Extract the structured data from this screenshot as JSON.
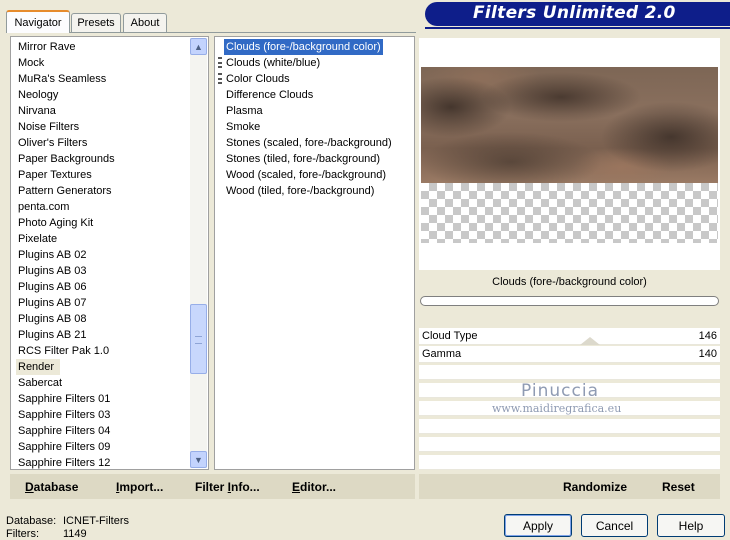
{
  "tabs": [
    "Navigator",
    "Presets",
    "About"
  ],
  "banner_title": "Filters Unlimited 2.0",
  "categories": [
    "Mirror Rave",
    "Mock",
    "MuRa's Seamless",
    "Neology",
    "Nirvana",
    "Noise Filters",
    "Oliver's Filters",
    "Paper Backgrounds",
    "Paper Textures",
    "Pattern Generators",
    "penta.com",
    "Photo Aging Kit",
    "Pixelate",
    "Plugins AB 02",
    "Plugins AB 03",
    "Plugins AB 06",
    "Plugins AB 07",
    "Plugins AB 08",
    "Plugins AB 21",
    "RCS Filter Pak 1.0",
    "Render",
    "Sabercat",
    "Sapphire Filters 01",
    "Sapphire Filters 03",
    "Sapphire Filters 04",
    "Sapphire Filters 09",
    "Sapphire Filters 12"
  ],
  "selected_category": "Render",
  "filters": [
    "Clouds (fore-/background color)",
    "Clouds (white/blue)",
    "Color Clouds",
    "Difference Clouds",
    "Plasma",
    "Smoke",
    "Stones (scaled, fore-/background)",
    "Stones (tiled, fore-/background)",
    "Wood (scaled, fore-/background)",
    "Wood (tiled, fore-/background)"
  ],
  "selected_filter": "Clouds (fore-/background color)",
  "preview_filter_name": "Clouds (fore-/background color)",
  "sliders": [
    {
      "label": "Cloud Type",
      "value": "146"
    },
    {
      "label": "Gamma",
      "value": "140"
    }
  ],
  "watermark": {
    "line1": "Pinuccia",
    "line2": "www.maidiregrafica.eu"
  },
  "toolbar": {
    "database": {
      "ul": "D",
      "rest": "atabase"
    },
    "import": {
      "ul": "I",
      "rest": "mport..."
    },
    "filter_info": {
      "pre": "Filter ",
      "ul": "I",
      "rest": "nfo..."
    },
    "editor": {
      "ul": "E",
      "rest": "ditor..."
    },
    "randomize": "Randomize",
    "reset": "Reset"
  },
  "buttons": {
    "apply": "Apply",
    "cancel": "Cancel",
    "help": "Help"
  },
  "status": {
    "database_label": "Database:",
    "database_value": "ICNET-Filters",
    "filters_label": "Filters:",
    "filters_value": "1149"
  },
  "colors": {
    "banner": "#0e1e8a",
    "selection": "#316ac5",
    "panel": "#ece9d8"
  }
}
